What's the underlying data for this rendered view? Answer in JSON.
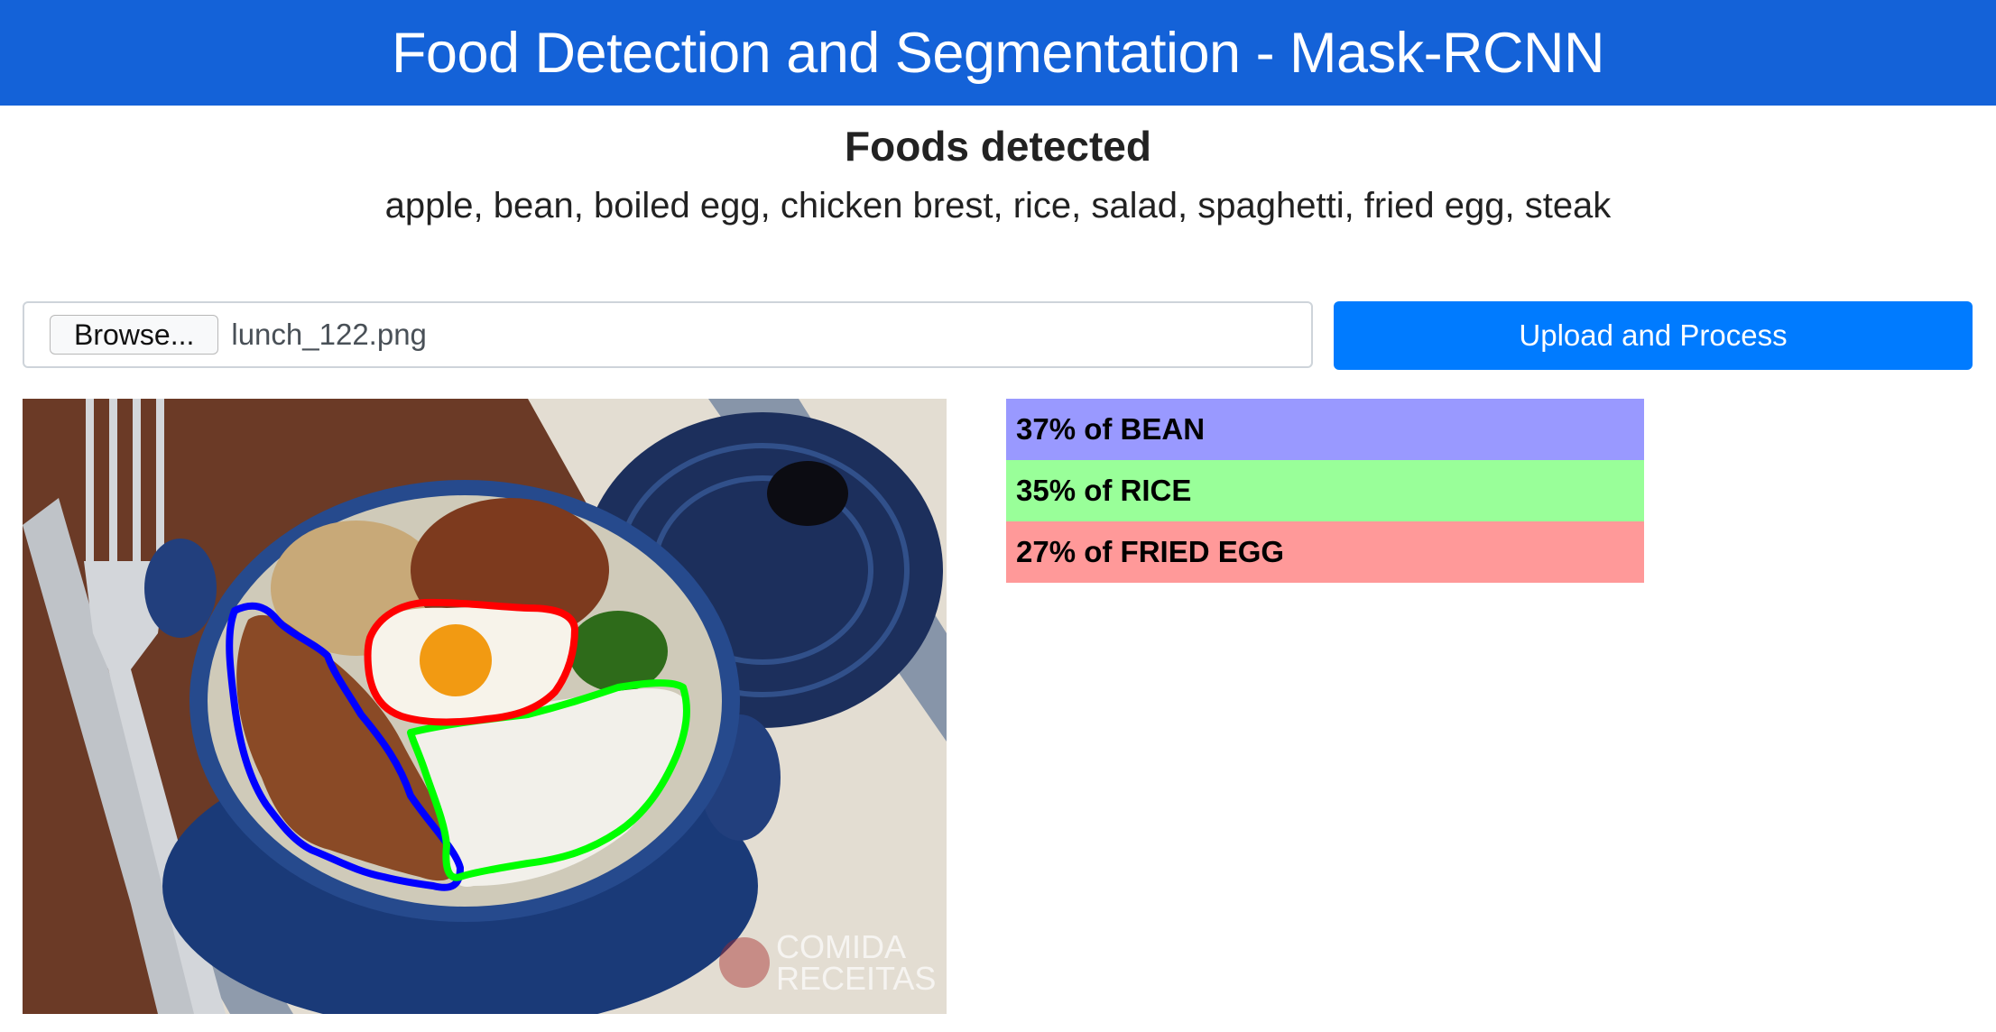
{
  "header": {
    "title": "Food Detection and Segmentation - Mask-RCNN"
  },
  "detected": {
    "heading": "Foods detected",
    "list": "apple, bean, boiled egg, chicken brest, rice, salad, spaghetti, fried egg, steak"
  },
  "upload": {
    "browse_label": "Browse...",
    "file_name": "lunch_122.png",
    "button_label": "Upload and Process"
  },
  "image": {
    "watermark_line1": "COMIDA",
    "watermark_line2": "RECEITAS",
    "mask_colors": {
      "bean": "#0000ff",
      "rice": "#00ff00",
      "fried_egg": "#ff0000"
    }
  },
  "results": [
    {
      "label": "37% of BEAN",
      "color": "#9999ff"
    },
    {
      "label": "35% of RICE",
      "color": "#99ff99"
    },
    {
      "label": "27% of FRIED EGG",
      "color": "#ff9999"
    }
  ]
}
